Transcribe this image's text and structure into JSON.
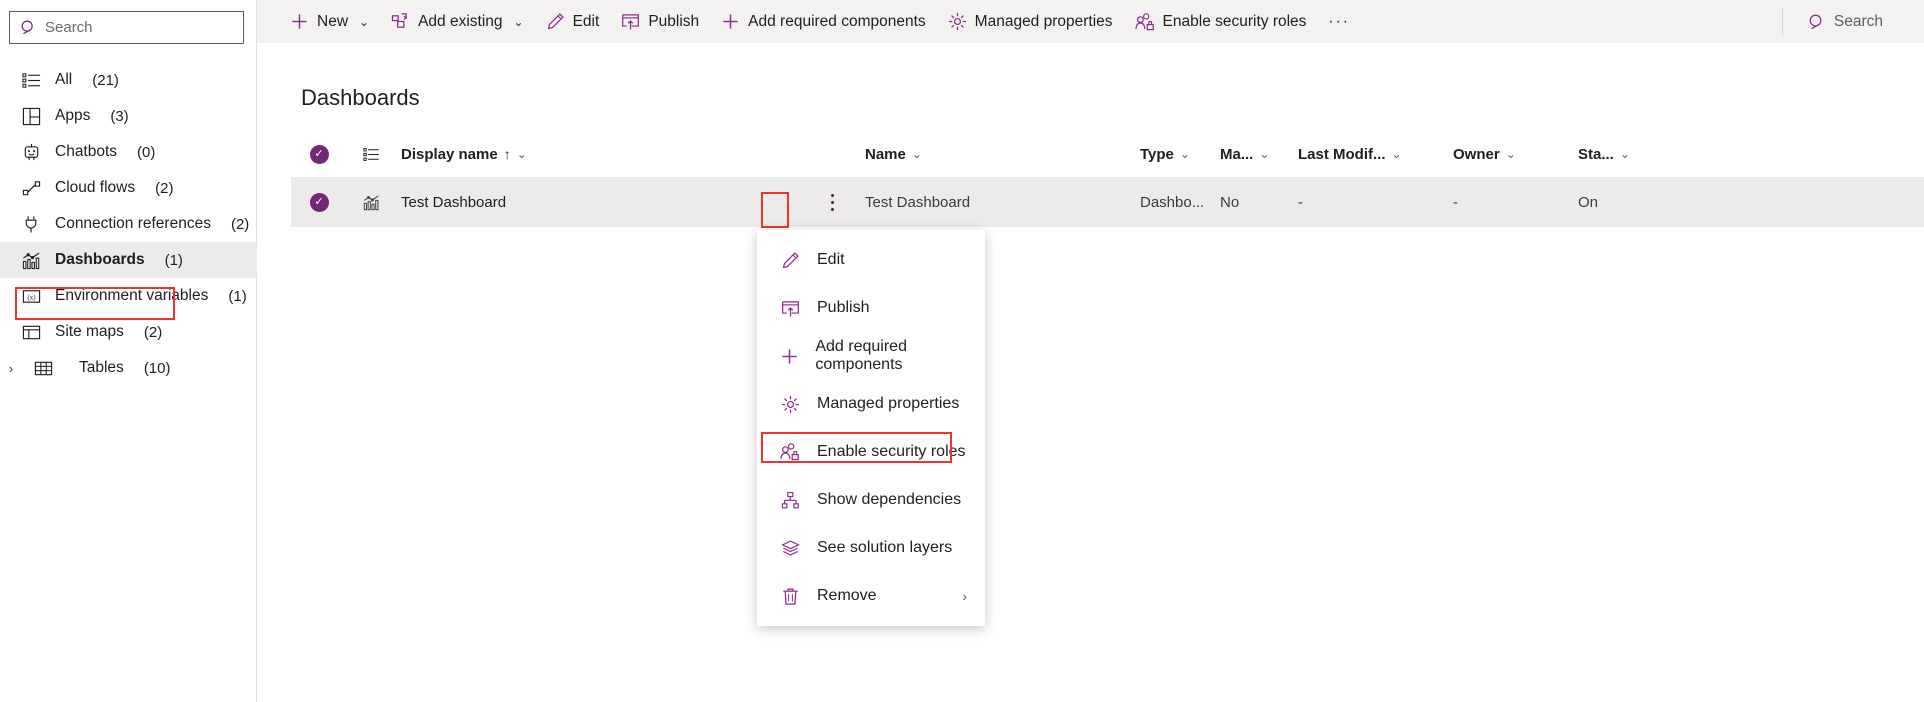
{
  "colors": {
    "accent": "#742774",
    "icon_purple": "#8a2b8a",
    "highlight_red": "#f03232",
    "row_selected_bg": "#edebe9",
    "commandbar_bg": "#f3f2f1"
  },
  "sidebar": {
    "search": {
      "placeholder": "Search",
      "value": "",
      "icon": "search-icon"
    },
    "items": [
      {
        "label": "All",
        "count": "(21)",
        "icon": "list-icon",
        "selected": false,
        "expandable": false
      },
      {
        "label": "Apps",
        "count": "(3)",
        "icon": "apps-grid-icon",
        "selected": false,
        "expandable": false
      },
      {
        "label": "Chatbots",
        "count": "(0)",
        "icon": "chatbot-icon",
        "selected": false,
        "expandable": false
      },
      {
        "label": "Cloud flows",
        "count": "(2)",
        "icon": "cloud-flow-icon",
        "selected": false,
        "expandable": false
      },
      {
        "label": "Connection references",
        "count": "(2)",
        "icon": "connection-reference-icon",
        "selected": false,
        "expandable": false
      },
      {
        "label": "Dashboards",
        "count": "(1)",
        "icon": "dashboard-chart-icon",
        "selected": true,
        "expandable": false
      },
      {
        "label": "Environment variables",
        "count": "(1)",
        "icon": "environment-variable-icon",
        "selected": false,
        "expandable": false
      },
      {
        "label": "Site maps",
        "count": "(2)",
        "icon": "site-map-icon",
        "selected": false,
        "expandable": false
      },
      {
        "label": "Tables",
        "count": "(10)",
        "icon": "table-icon",
        "selected": false,
        "expandable": true
      }
    ]
  },
  "commandbar": {
    "items": [
      {
        "label": "New",
        "icon": "plus-icon",
        "caret": "⌄"
      },
      {
        "label": "Add existing",
        "icon": "add-existing-icon",
        "caret": "⌄"
      },
      {
        "label": "Edit",
        "icon": "pencil-icon",
        "caret": ""
      },
      {
        "label": "Publish",
        "icon": "publish-icon",
        "caret": ""
      },
      {
        "label": "Add required components",
        "icon": "plus-icon",
        "caret": ""
      },
      {
        "label": "Managed properties",
        "icon": "gear-icon",
        "caret": ""
      },
      {
        "label": "Enable security roles",
        "icon": "security-roles-icon",
        "caret": ""
      },
      {
        "label": "···",
        "icon": "overflow-icon",
        "caret": ""
      }
    ],
    "search": {
      "placeholder": "Search",
      "value": "",
      "icon": "search-icon"
    }
  },
  "main": {
    "title": "Dashboards",
    "grid": {
      "select_all_icon": "checkmark-circle-icon",
      "type_column_icon": "list-icon",
      "columns": [
        {
          "key": "display_name",
          "label": "Display name",
          "sort": "↑",
          "caret": "⌄"
        },
        {
          "key": "name",
          "label": "Name",
          "sort": "",
          "caret": "⌄"
        },
        {
          "key": "type",
          "label": "Type",
          "sort": "",
          "caret": "⌄"
        },
        {
          "key": "managed",
          "label": "Ma...",
          "sort": "",
          "caret": "⌄"
        },
        {
          "key": "last_modified",
          "label": "Last Modif...",
          "sort": "",
          "caret": "⌄"
        },
        {
          "key": "owner",
          "label": "Owner",
          "sort": "",
          "caret": "⌄"
        },
        {
          "key": "status",
          "label": "Sta...",
          "sort": "",
          "caret": "⌄"
        }
      ],
      "rows": [
        {
          "selected": true,
          "row_icon": "dashboard-chart-icon",
          "display_name": "Test Dashboard",
          "name": "Test Dashboard",
          "type": "Dashbo...",
          "managed": "No",
          "last_modified": "-",
          "owner": "-",
          "status": "On"
        }
      ]
    }
  },
  "context_menu": {
    "items": [
      {
        "label": "Edit",
        "icon": "pencil-icon",
        "highlighted": false,
        "submenu": false
      },
      {
        "label": "Publish",
        "icon": "publish-icon",
        "highlighted": false,
        "submenu": false
      },
      {
        "label": "Add required components",
        "icon": "plus-icon",
        "highlighted": false,
        "submenu": false
      },
      {
        "label": "Managed properties",
        "icon": "gear-icon",
        "highlighted": false,
        "submenu": false
      },
      {
        "label": "Enable security roles",
        "icon": "security-roles-icon",
        "highlighted": true,
        "submenu": false
      },
      {
        "label": "Show dependencies",
        "icon": "dependencies-icon",
        "highlighted": false,
        "submenu": false
      },
      {
        "label": "See solution layers",
        "icon": "layers-icon",
        "highlighted": false,
        "submenu": false
      },
      {
        "label": "Remove",
        "icon": "trash-icon",
        "highlighted": false,
        "submenu": true,
        "submenu_arrow": "›"
      }
    ]
  }
}
